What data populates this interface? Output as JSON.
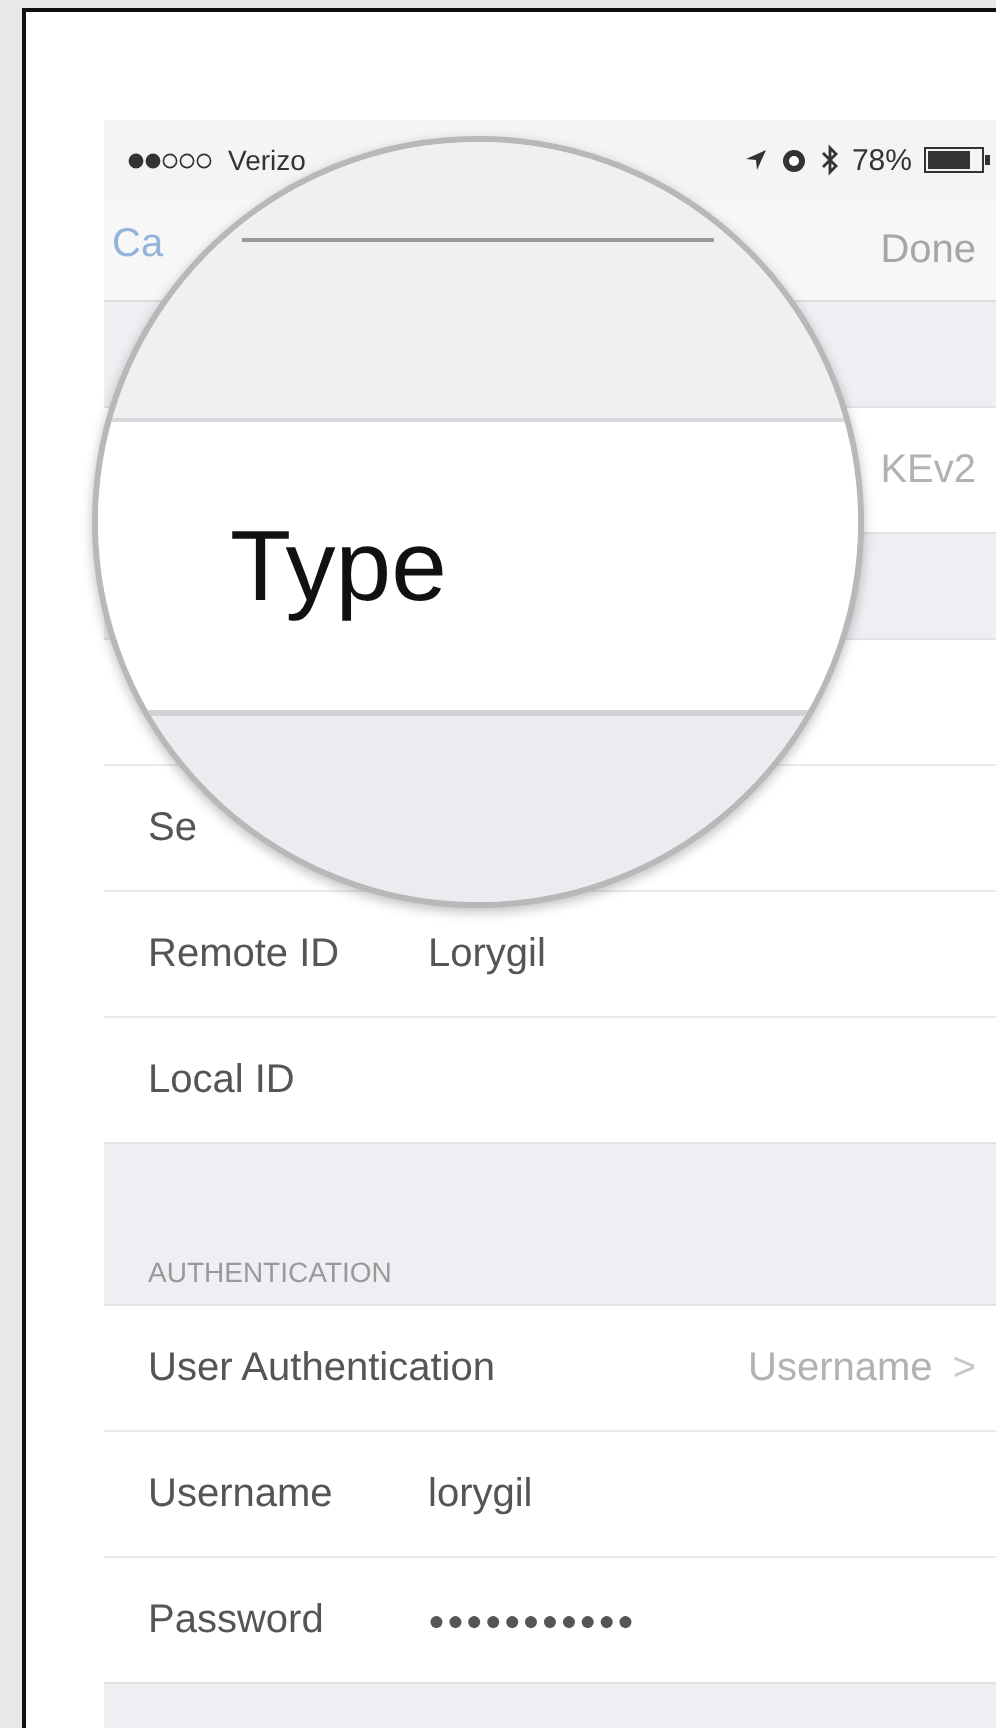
{
  "status_bar": {
    "carrier": "Verizo",
    "battery": "78%"
  },
  "nav": {
    "cancel": "Ca",
    "done": "Done"
  },
  "groups": [
    {
      "rows": [
        {
          "kind": "detail",
          "value": "KEv2"
        }
      ]
    },
    {
      "rows": [
        {
          "kind": "blank"
        },
        {
          "kind": "label",
          "label": "Se"
        },
        {
          "kind": "field",
          "label": "Remote ID",
          "value": "Lorygil"
        },
        {
          "kind": "label",
          "label": "Local ID"
        }
      ]
    },
    {
      "header": "AUTHENTICATION",
      "rows": [
        {
          "kind": "detail",
          "label": "User Authentication",
          "value": "Username",
          "chevron": ">"
        },
        {
          "kind": "field",
          "label": "Username",
          "value": "lorygil"
        },
        {
          "kind": "secure",
          "label": "Password",
          "value": "●●●●●●●●●●●"
        }
      ]
    }
  ],
  "magnifier": {
    "text": "Type"
  }
}
